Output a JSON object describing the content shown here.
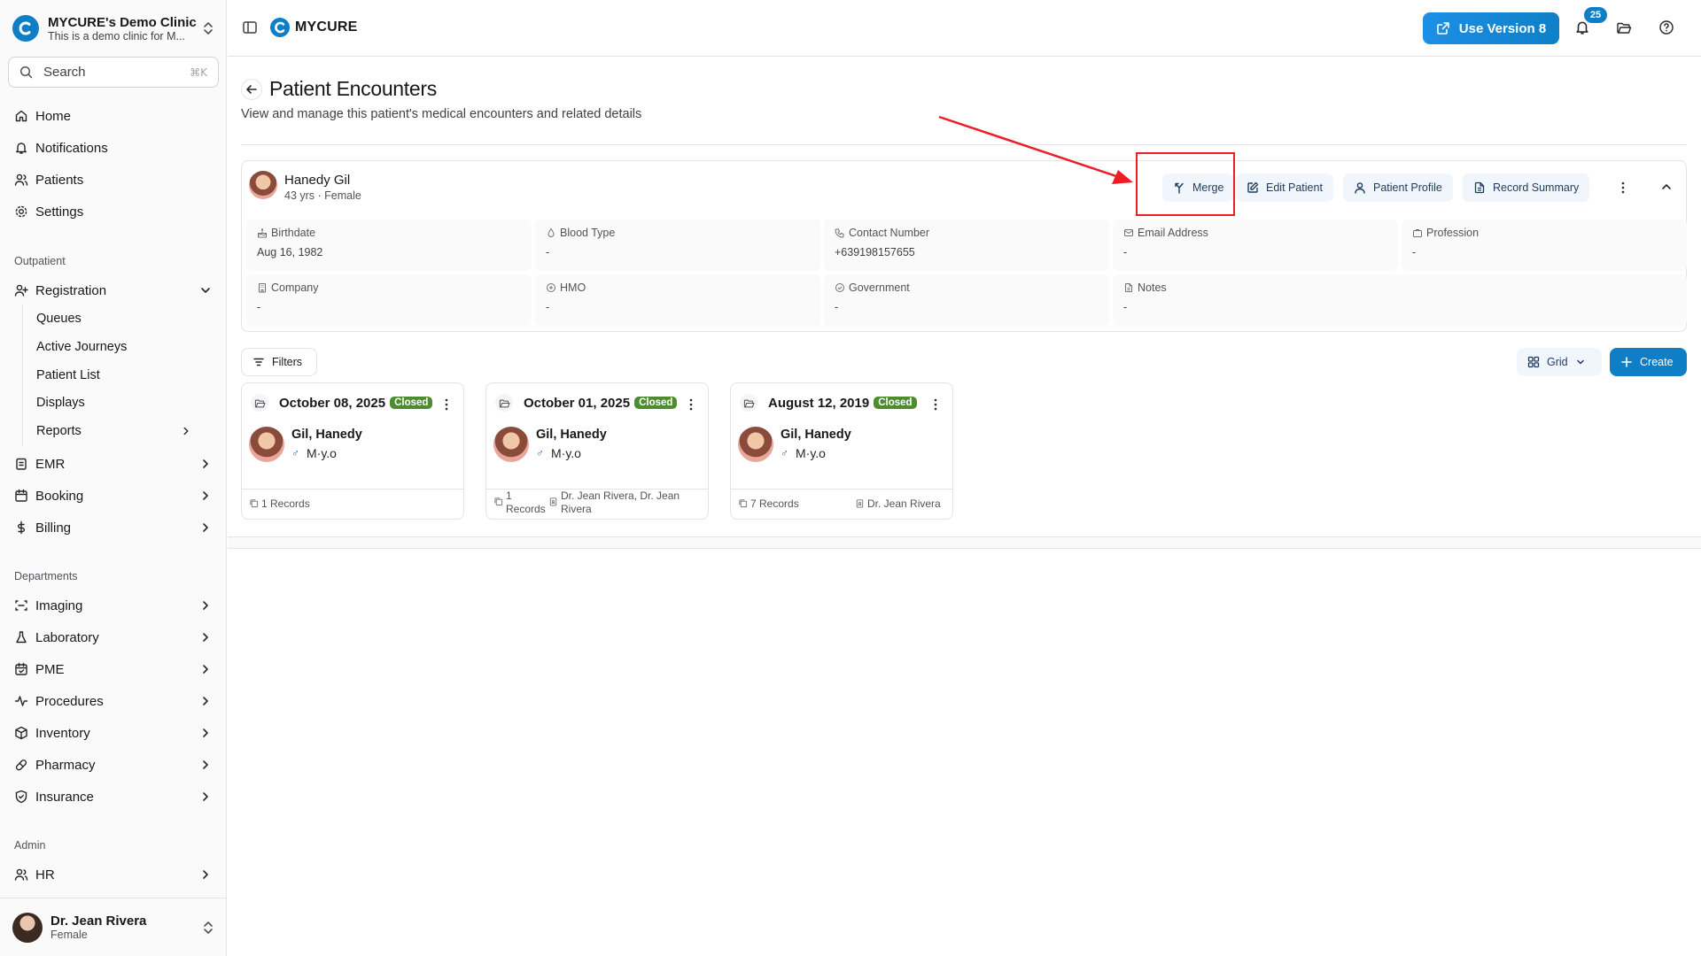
{
  "sidebar": {
    "clinic_name": "MYCURE's Demo Clinic",
    "clinic_desc": "This is a demo clinic for M...",
    "search_label": "Search",
    "search_shortcut": "⌘K",
    "main_items": [
      {
        "label": "Home"
      },
      {
        "label": "Notifications"
      },
      {
        "label": "Patients"
      },
      {
        "label": "Settings"
      }
    ],
    "outpatient_label": "Outpatient",
    "registration_label": "Registration",
    "registration_sub": [
      {
        "label": "Queues"
      },
      {
        "label": "Active Journeys"
      },
      {
        "label": "Patient List"
      },
      {
        "label": "Displays"
      },
      {
        "label": "Reports"
      }
    ],
    "outpatient_items": [
      {
        "label": "EMR"
      },
      {
        "label": "Booking"
      },
      {
        "label": "Billing"
      }
    ],
    "departments_label": "Departments",
    "department_items": [
      {
        "label": "Imaging"
      },
      {
        "label": "Laboratory"
      },
      {
        "label": "PME"
      },
      {
        "label": "Procedures"
      },
      {
        "label": "Inventory"
      },
      {
        "label": "Pharmacy"
      },
      {
        "label": "Insurance"
      }
    ],
    "admin_label": "Admin",
    "admin_items": [
      {
        "label": "HR"
      }
    ],
    "user": {
      "name": "Dr. Jean Rivera",
      "sub": "Female"
    }
  },
  "topbar": {
    "brand": "MYCURE",
    "version_button": "Use Version 8",
    "notification_count": "25"
  },
  "page": {
    "title": "Patient Encounters",
    "subtitle": "View and manage this patient's medical encounters and related details"
  },
  "patient": {
    "name": "Hanedy Gil",
    "meta": "43 yrs · Female",
    "actions": {
      "merge": "Merge",
      "edit": "Edit Patient",
      "profile": "Patient Profile",
      "summary": "Record Summary"
    },
    "fields": [
      {
        "label": "Birthdate",
        "value": "Aug 16, 1982",
        "icon": "cake-icon"
      },
      {
        "label": "Blood Type",
        "value": "-",
        "icon": "droplet-icon"
      },
      {
        "label": "Contact Number",
        "value": "+639198157655",
        "icon": "phone-icon"
      },
      {
        "label": "Email Address",
        "value": "-",
        "icon": "mail-icon"
      },
      {
        "label": "Profession",
        "value": "-",
        "icon": "briefcase-icon"
      },
      {
        "label": "Company",
        "value": "-",
        "icon": "building-icon"
      },
      {
        "label": "HMO",
        "value": "-",
        "icon": "shield-plus-icon"
      },
      {
        "label": "Government",
        "value": "-",
        "icon": "badge-check-icon"
      },
      {
        "label": "Notes",
        "value": "-",
        "icon": "file-icon"
      }
    ]
  },
  "toolbar": {
    "filters": "Filters",
    "view": "Grid",
    "create": "Create"
  },
  "encounters": [
    {
      "date": "October 08, 2025",
      "status": "Closed",
      "patient": "Gil, Hanedy",
      "sex_age": "M·y.o",
      "records": "1 Records",
      "doctor": ""
    },
    {
      "date": "October 01, 2025",
      "status": "Closed",
      "patient": "Gil, Hanedy",
      "sex_age": "M·y.o",
      "records_line1": "1",
      "records_line2": "Records",
      "doctor_line1": "Dr. Jean Rivera, Dr. Jean",
      "doctor_line2": "Rivera"
    },
    {
      "date": "August 12, 2019",
      "status": "Closed",
      "patient": "Gil, Hanedy",
      "sex_age": "M·y.o",
      "records": "7 Records",
      "doctor": "Dr. Jean Rivera"
    }
  ],
  "colors": {
    "accent": "#0e7fc7",
    "status_closed": "#4d8c2f",
    "annotation_red": "#ee1c24"
  }
}
